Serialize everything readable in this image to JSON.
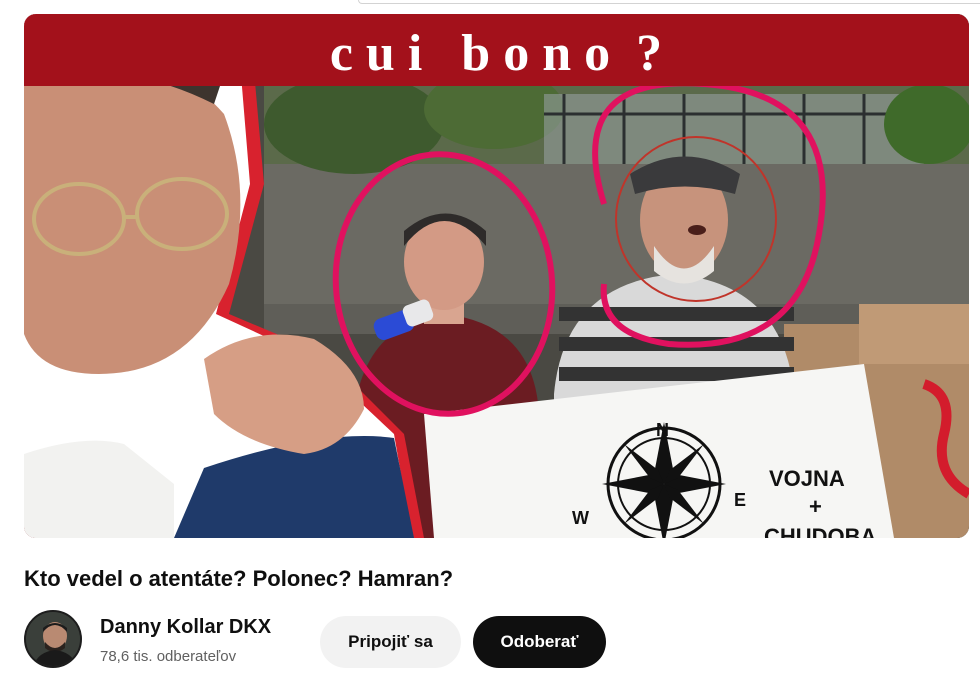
{
  "video": {
    "thumbnail_banner": "c u i   b o n o  ?",
    "sign_text_1": "VOJNA",
    "sign_text_2": "+",
    "sign_text_3": "CHUDOBA",
    "compass_n": "N",
    "compass_w": "W",
    "compass_e": "E",
    "title": "Kto vedel o atentáte? Polonec? Hamran?"
  },
  "channel": {
    "name": "Danny Kollar DKX",
    "subscribers": "78,6 tis. odberateľov",
    "avatar_icon": "channel-avatar"
  },
  "actions": {
    "join_label": "Pripojiť sa",
    "subscribe_label": "Odoberať"
  },
  "colors": {
    "banner_red": "#a3111b",
    "highlight_pink": "#e0115f",
    "subscribe_bg": "#0f0f0f",
    "join_bg": "#f2f2f2"
  }
}
